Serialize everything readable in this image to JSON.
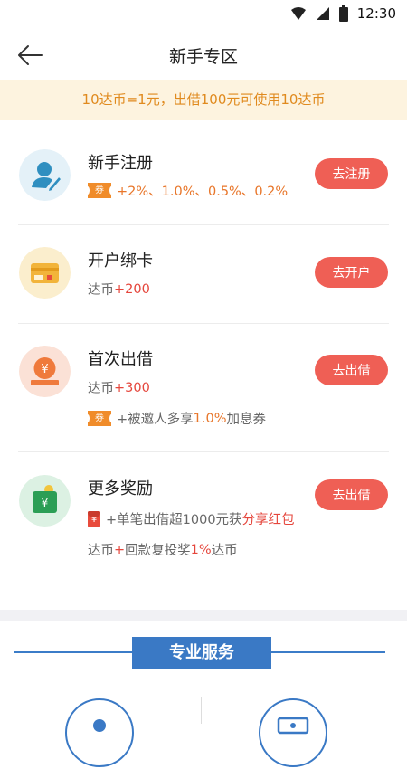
{
  "status_bar": {
    "time": "12:30",
    "icons": [
      "wifi-icon",
      "signal-icon",
      "battery-icon"
    ]
  },
  "header": {
    "title": "新手专区",
    "back_icon": "arrow-left-icon"
  },
  "notice": {
    "text": "10达币=1元，出借100元可使用10达币"
  },
  "tasks": [
    {
      "title": "新手注册",
      "icon": "user-edit-icon",
      "button": "去注册",
      "lines": [
        {
          "badge": "券",
          "segments": [
            {
              "text": "+2%、1.0%、0.5%、0.2%",
              "color": "orange"
            }
          ]
        }
      ]
    },
    {
      "title": "开户绑卡",
      "icon": "bank-card-icon",
      "button": "去开户",
      "lines": [
        {
          "segments": [
            {
              "text": "达币 ",
              "color": "gray"
            },
            {
              "text": "+200",
              "color": "red"
            }
          ]
        }
      ]
    },
    {
      "title": "首次出借",
      "icon": "coin-yen-icon",
      "button": "去出借",
      "lines": [
        {
          "segments": [
            {
              "text": "达币 ",
              "color": "gray"
            },
            {
              "text": "+300",
              "color": "red"
            }
          ]
        },
        {
          "badge": "券",
          "segments": [
            {
              "text": "+被邀人多享",
              "color": "gray"
            },
            {
              "text": "1.0%",
              "color": "orange"
            },
            {
              "text": "加息券",
              "color": "gray"
            }
          ]
        }
      ]
    },
    {
      "title": "更多奖励",
      "icon": "wallet-yen-icon",
      "button": "去出借",
      "lines": [
        {
          "badge": "¥",
          "segments": [
            {
              "text": "+单笔出借超1000元获",
              "color": "gray"
            },
            {
              "text": "分享红包",
              "color": "red"
            }
          ]
        },
        {
          "segments": [
            {
              "text": "达币",
              "color": "gray"
            },
            {
              "text": "+",
              "color": "red"
            },
            {
              "text": "回款复投奖",
              "color": "gray"
            },
            {
              "text": "1%",
              "color": "red"
            },
            {
              "text": "达币",
              "color": "gray"
            }
          ]
        }
      ]
    }
  ],
  "services": {
    "title": "专业服务",
    "icons": [
      "person-icon",
      "money-bill-icon"
    ]
  },
  "colors": {
    "accent_blue": "#3a79c5",
    "button_red": "#ef5f55",
    "notice_bg": "#fdf3df",
    "notice_text": "#e08a1e"
  }
}
